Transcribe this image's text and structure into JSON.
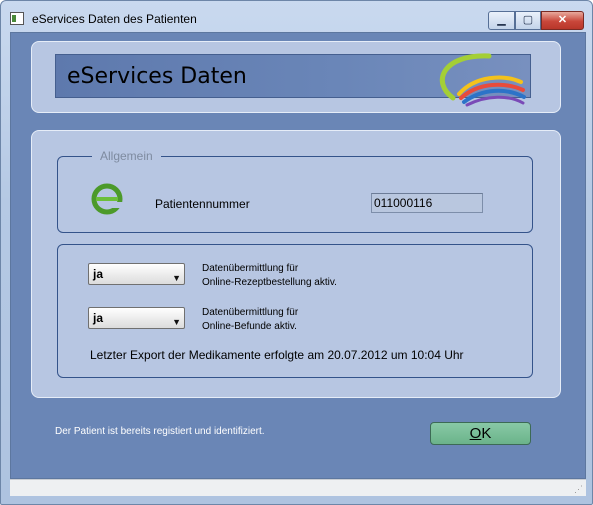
{
  "window": {
    "title": "eServices Daten des Patienten",
    "buttons": {
      "minimize": "▁",
      "maximize": "▢",
      "close": "✕"
    }
  },
  "header": {
    "title": "eServices Daten",
    "logo_icon": "swoosh-logo"
  },
  "general": {
    "legend": "Allgemein",
    "icon": "e-logo-icon",
    "patient_label": "Patientennummer",
    "patient_value": "011000116"
  },
  "transfer": {
    "prescription": {
      "value": "ja",
      "label_line1": "Datenübermittlung für",
      "label_line2": "Online-Rezeptbestellung aktiv."
    },
    "findings": {
      "value": "ja",
      "label_line1": "Datenübermittlung für",
      "label_line2": "Online-Befunde aktiv."
    },
    "export_info": "Letzter Export der Medikamente erfolgte am 20.07.2012 um 10:04 Uhr"
  },
  "footer": {
    "status": "Der Patient ist bereits registiert und identifiziert.",
    "ok_label_underlined": "O",
    "ok_label_rest": "K"
  },
  "colors": {
    "client_background": "#6a86b6",
    "panel_background": "#b7c6e2",
    "ok_button": "#6bb38a",
    "header_bar": "#6a86b8"
  }
}
